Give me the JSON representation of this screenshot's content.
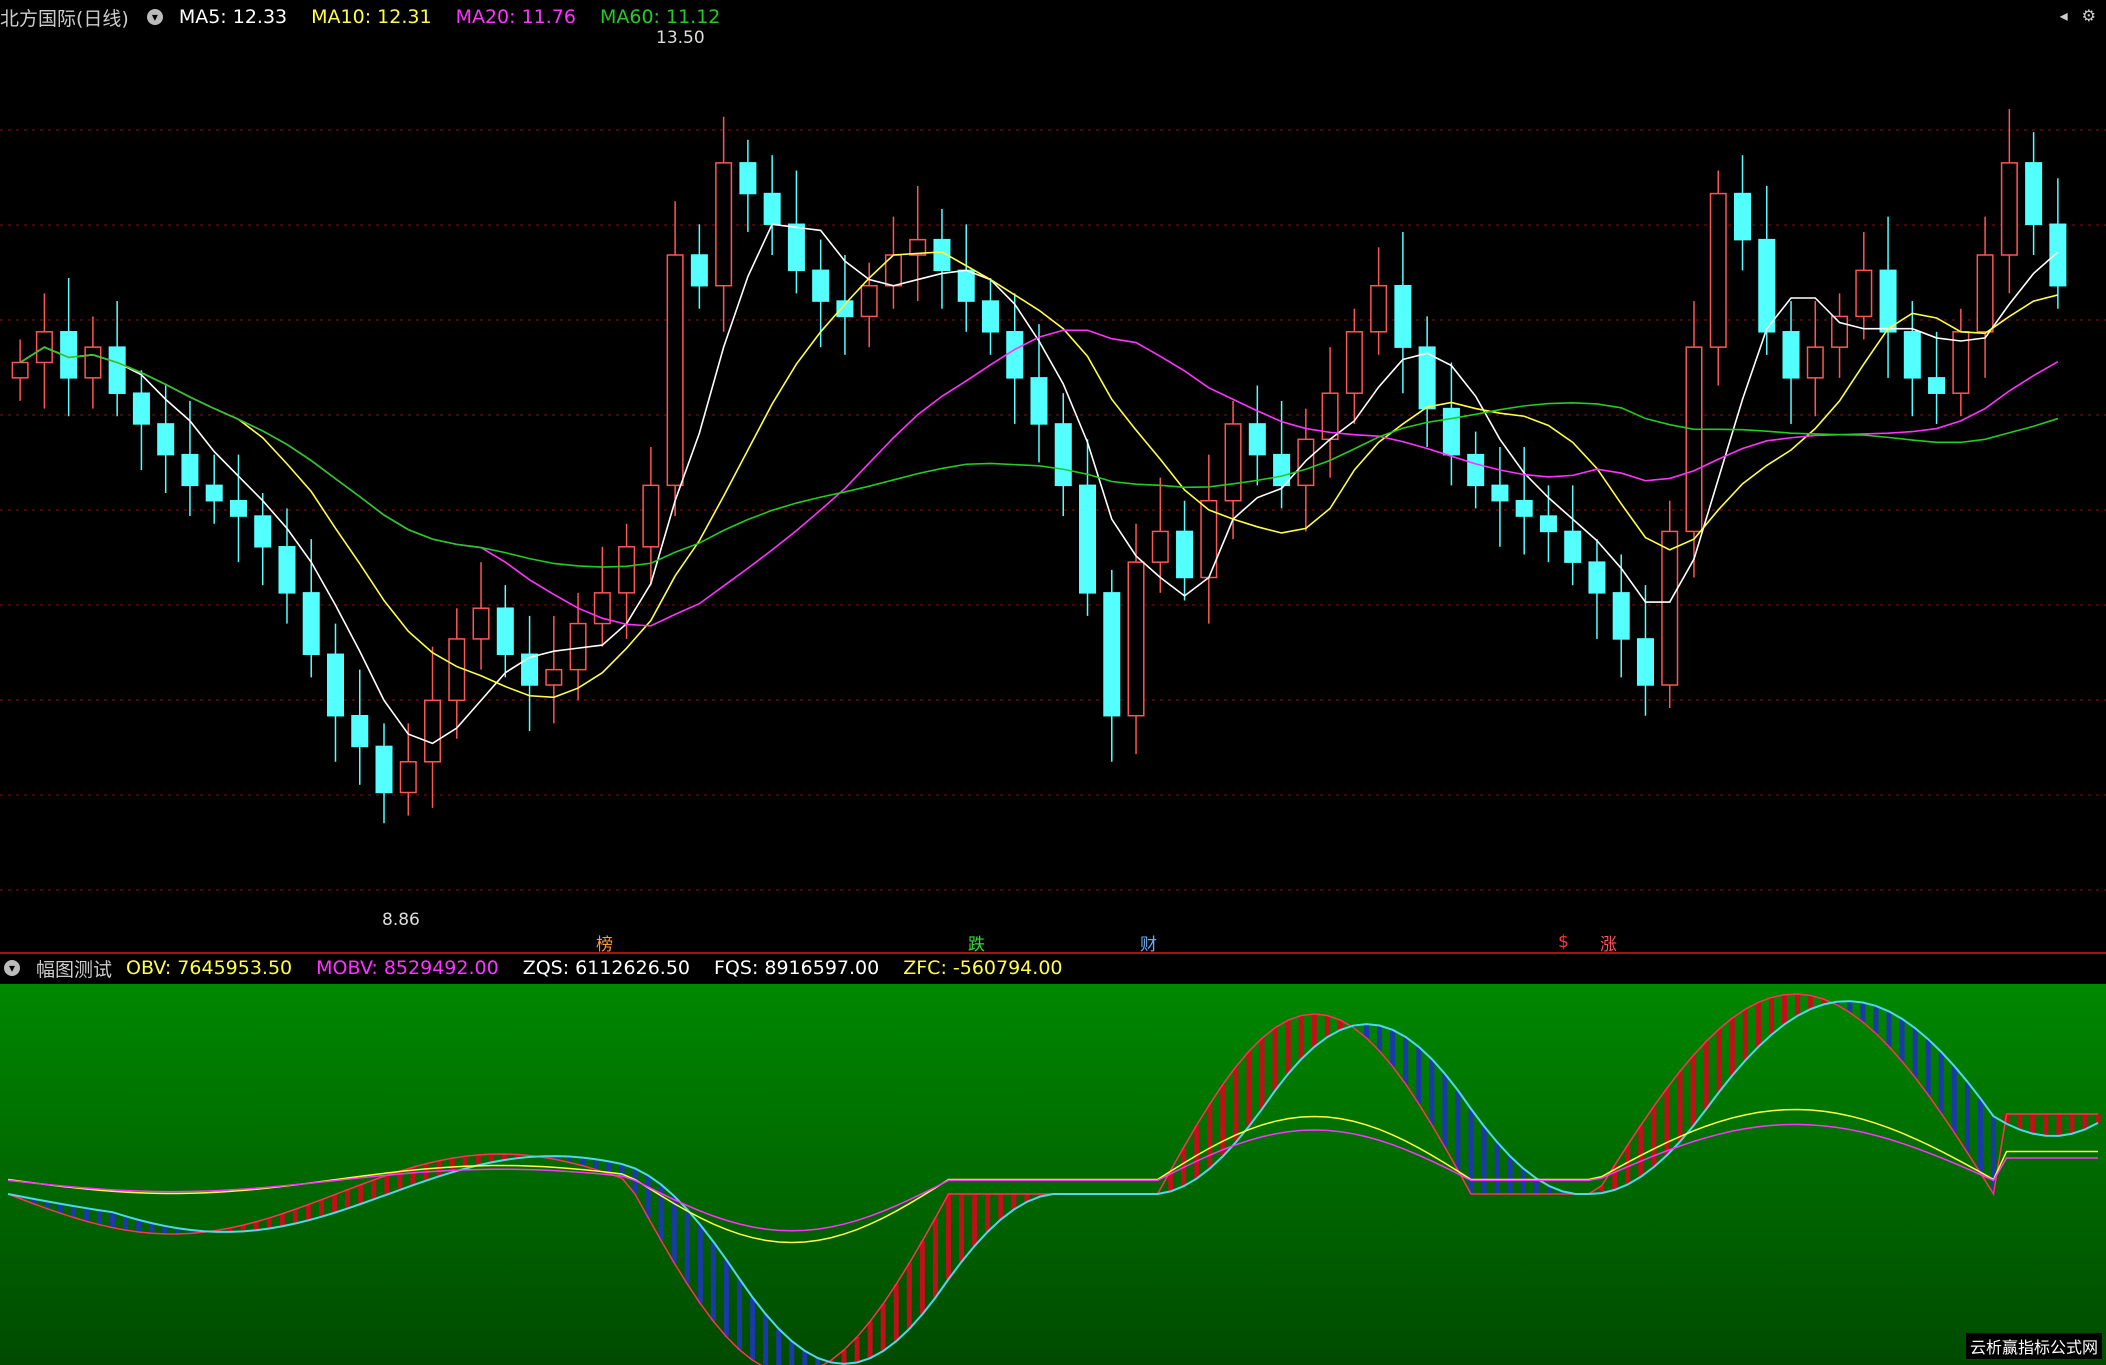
{
  "top_legend": {
    "title": "北方国际(日线)",
    "ma5": "MA5: 12.33",
    "ma10": "MA10: 12.31",
    "ma20": "MA20: 11.76",
    "ma60": "MA60: 11.12"
  },
  "bottom_legend": {
    "title": "幅图测试",
    "obv": "OBV: 7645953.50",
    "mobv": "MOBV: 8529492.00",
    "zqs": "ZQS: 6112626.50",
    "fqs": "FQS: 8916597.00",
    "zfc": "ZFC: -560794.00"
  },
  "annotations": {
    "high": "13.50",
    "low": "8.86"
  },
  "event_markers": [
    {
      "label": "榜",
      "color": "#ff9a3c"
    },
    {
      "label": "跌",
      "color": "#33dd33"
    },
    {
      "label": "财",
      "color": "#6fa8ff"
    },
    {
      "label": "$",
      "color": "#ff3333"
    },
    {
      "label": "涨",
      "color": "#ff5555"
    }
  ],
  "watermark": "云析赢指标公式网",
  "colors": {
    "up": "#ff5555",
    "down": "#54ffff",
    "ma5": "#ffffff",
    "ma10": "#ffff44",
    "ma20": "#ff33ff",
    "ma60": "#22cc22",
    "panel_green": "#007a00"
  },
  "chart_data": {
    "type": "candlestick",
    "y_range": [
      8.86,
      13.5
    ],
    "candles_close": [
      11.7,
      11.9,
      11.6,
      11.8,
      11.5,
      11.3,
      11.1,
      10.9,
      10.8,
      10.7,
      10.5,
      10.2,
      9.8,
      9.4,
      9.2,
      8.9,
      9.1,
      9.5,
      9.9,
      10.1,
      9.8,
      9.6,
      9.7,
      10.0,
      10.2,
      10.5,
      10.9,
      12.4,
      12.2,
      13.0,
      12.8,
      12.6,
      12.3,
      12.1,
      12.0,
      12.2,
      12.4,
      12.5,
      12.3,
      12.1,
      11.9,
      11.6,
      11.3,
      10.9,
      10.2,
      9.4,
      10.4,
      10.6,
      10.3,
      10.8,
      11.3,
      11.1,
      10.9,
      11.2,
      11.5,
      11.9,
      12.2,
      11.8,
      11.4,
      11.1,
      10.9,
      10.8,
      10.7,
      10.6,
      10.4,
      10.2,
      9.9,
      9.6,
      10.6,
      11.8,
      12.8,
      12.5,
      11.9,
      11.6,
      11.8,
      12.0,
      12.3,
      11.9,
      11.6,
      11.5,
      11.9,
      12.4,
      13.0,
      12.6,
      12.2
    ]
  }
}
